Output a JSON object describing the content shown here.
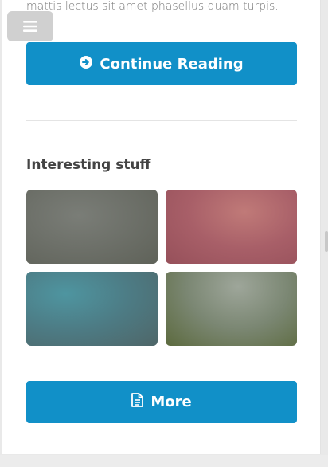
{
  "excerpt": {
    "text": "mattis lectus sit amet phasellus quam turpis."
  },
  "menu": {
    "icon": "hamburger-icon"
  },
  "continue_button": {
    "label": "Continue Reading",
    "icon": "arrow-circle-right-icon"
  },
  "section": {
    "title": "Interesting stuff"
  },
  "gallery": {
    "items": [
      {
        "color": "#6e716a"
      },
      {
        "color": "#a85f68"
      },
      {
        "color": "#4d7b84"
      },
      {
        "color": "#7b8773"
      }
    ]
  },
  "more_button": {
    "label": "More",
    "icon": "document-icon"
  },
  "colors": {
    "accent": "#1190c8",
    "background": "#e9e9e9",
    "card": "#ffffff"
  }
}
